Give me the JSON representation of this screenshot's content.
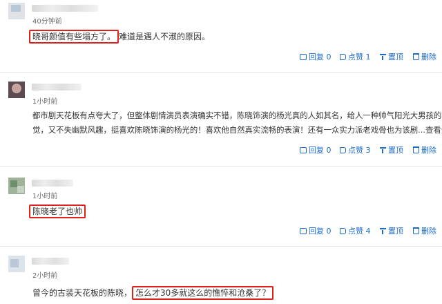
{
  "comments": [
    {
      "time": "40分钟前",
      "text_highlight": "晓哥颜值有些塌方了。",
      "text_rest": "难道是遇人不淑的原因。",
      "actions": {
        "reply": "回复 0",
        "like": "点赞 1",
        "top": "置顶",
        "delete": "删除"
      }
    },
    {
      "time": "1小时前",
      "line1": "都市剧天花板有点夸大了，但整体剧情演员表演确实不错，陈晓饰演的杨光真的人如其名，给人一种帅气阳光大男孩的感",
      "line2": "觉，又不失幽默风趣，挺喜欢陈晓饰演的杨光的！喜欢他自然真实流畅的表演！还有一众实力派老戏骨也为该剧",
      "more": "...查看全部",
      "actions": {
        "reply": "回复 0",
        "like": "点赞 3",
        "top": "置顶",
        "delete": "删除"
      }
    },
    {
      "time": "1小时前",
      "text_highlight": "陈晓老了也帅",
      "actions": {
        "reply": "回复 0",
        "like": "点赞 4",
        "top": "置顶",
        "delete": "删除"
      }
    },
    {
      "time": "2小时前",
      "text_prefix": "曾今的古装天花板的陈晓，",
      "text_highlight": "怎么才30多就这么的憔悴和沧桑了？"
    }
  ],
  "colors": {
    "highlight_border": "#e0201a",
    "action_blue": "#1a6ac8"
  },
  "icons": [
    "reply-icon",
    "like-icon",
    "pin-icon",
    "delete-icon",
    "chevron-down-icon"
  ]
}
